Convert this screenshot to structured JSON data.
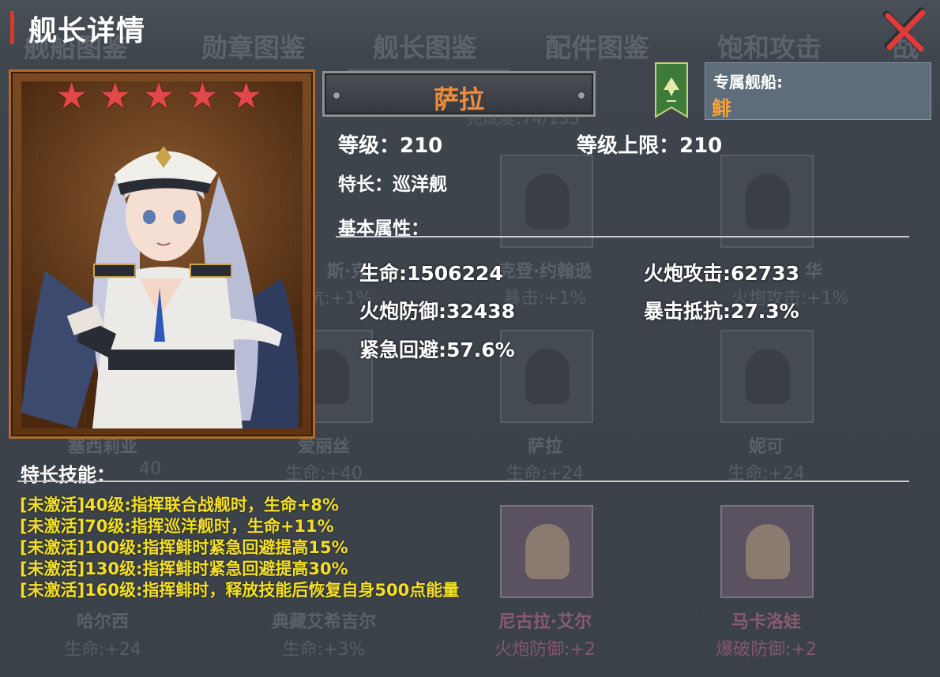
{
  "window": {
    "title": "舰长详情"
  },
  "background": {
    "tabs": [
      "舰船图鉴",
      "勋章图鉴",
      "舰长图鉴",
      "配件图鉴",
      "饱和攻击",
      "战"
    ],
    "progress": "完成度:74/135",
    "cards": [
      {
        "name": "斯·克",
        "stat": "抗:+1%"
      },
      {
        "name": "克登·约翰逊",
        "stat": "暴击:+1%"
      },
      {
        "name": "华",
        "stat": "火炮攻击:+1%"
      },
      {
        "name": "塞西莉亚",
        "stat": "40"
      },
      {
        "name": "爱丽丝",
        "stat": "生命:+40"
      },
      {
        "name": "萨拉",
        "stat": "生命:+24"
      },
      {
        "name": "妮可",
        "stat": "生命:+24"
      },
      {
        "name": "哈尔西",
        "stat": "生命:+24"
      },
      {
        "name": "典藏艾希吉尔",
        "stat": "生命:+3%"
      },
      {
        "name": "尼古拉·艾尔",
        "stat": "火炮防御:+2"
      },
      {
        "name": "马卡洛娃",
        "stat": "爆破防御:+2"
      }
    ]
  },
  "captain": {
    "stars": 5,
    "name": "萨拉",
    "level": "等级：210",
    "level_cap": "等级上限：210",
    "specialty": "特长：巡洋舰",
    "exclusive_ship_label": "专属舰船:",
    "exclusive_ship": "鲱"
  },
  "attributes": {
    "heading": "基本属性：",
    "hp": "生命:1506224",
    "gun_attack": "火炮攻击:62733",
    "gun_defense": "火炮防御:32438",
    "crit_resist": "暴击抵抗:27.3%",
    "evasion": "紧急回避:57.6%"
  },
  "skills": {
    "heading": "特长技能：",
    "lines": [
      "[未激活]40级:指挥联合战舰时，生命+8%",
      "[未激活]70级:指挥巡洋舰时，生命+11%",
      "[未激活]100级:指挥鲱时紧急回避提高15%",
      "[未激活]130级:指挥鲱时紧急回避提高30%",
      "[未激活]160级:指挥鲱时，释放技能后恢复自身500点能量"
    ]
  },
  "colors": {
    "accent": "#d43a2a",
    "name": "#f08c3c",
    "ship_name": "#f0a23c",
    "skill_text": "#f3df25",
    "star": "#e0484a"
  },
  "icons": {
    "close": "close-x-icon",
    "star": "star-icon",
    "flag": "ship-flag-icon"
  }
}
